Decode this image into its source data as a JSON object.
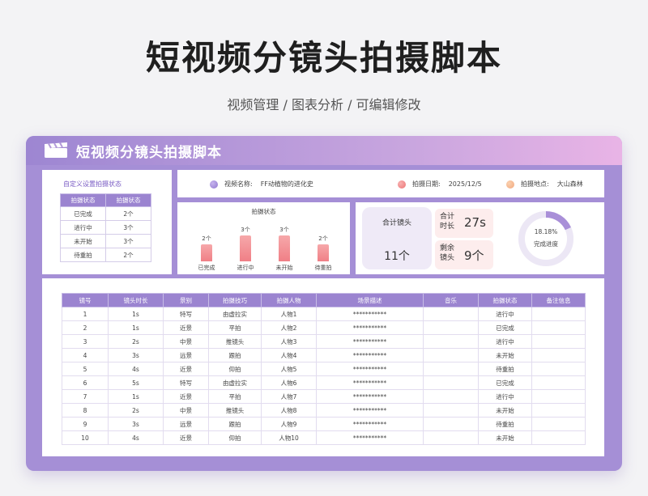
{
  "page": {
    "title": "短视频分镜头拍摄脚本",
    "subtitle": "视频管理 / 图表分析 /  可编辑修改"
  },
  "card": {
    "title": "短视频分镜头拍摄脚本",
    "icon": "clapperboard-icon",
    "colors": {
      "accent": "#9b84d0",
      "bar": "#f07f86",
      "donut": "#a98fd8"
    }
  },
  "status_panel": {
    "title": "自定义设置拍摄状态",
    "headers": [
      "拍摄状态",
      "拍摄状态"
    ],
    "rows": [
      {
        "status": "已完成",
        "count": "2个"
      },
      {
        "status": "进行中",
        "count": "3个"
      },
      {
        "status": "未开始",
        "count": "3个"
      },
      {
        "status": "待重拍",
        "count": "2个"
      }
    ]
  },
  "info": {
    "video_name_label": "视频名称:",
    "video_name": "FF动植物的进化史",
    "date_label": "拍摄日期:",
    "date": "2025/12/5",
    "location_label": "拍摄地点:",
    "location": "大山森林"
  },
  "chart_data": {
    "type": "bar",
    "title": "拍摄状态",
    "categories": [
      "已完成",
      "进行中",
      "未开始",
      "待重拍"
    ],
    "values": [
      2,
      3,
      3,
      2
    ],
    "value_labels": [
      "2个",
      "3个",
      "3个",
      "2个"
    ],
    "ylim": [
      0,
      3
    ],
    "grid": false
  },
  "stats": {
    "total_label": "合计镜头",
    "total_value": "11个",
    "duration_label": "合计时长",
    "duration_value": "27s",
    "remaining_label": "剩余镜头",
    "remaining_value": "9个",
    "progress_value": 0.1818,
    "progress_text": "18.18%",
    "progress_label": "完成进度"
  },
  "table": {
    "headers": [
      "镜号",
      "镜头时长",
      "景别",
      "拍摄技巧",
      "拍摄人物",
      "场景描述",
      "音乐",
      "拍摄状态",
      "备注信息"
    ],
    "rows": [
      [
        "1",
        "1s",
        "特写",
        "由虚拉实",
        "人物1",
        "***********",
        "",
        "进行中",
        ""
      ],
      [
        "2",
        "1s",
        "近景",
        "平拍",
        "人物2",
        "***********",
        "",
        "已完成",
        ""
      ],
      [
        "3",
        "2s",
        "中景",
        "推镜头",
        "人物3",
        "***********",
        "",
        "进行中",
        ""
      ],
      [
        "4",
        "3s",
        "远景",
        "跟拍",
        "人物4",
        "***********",
        "",
        "未开始",
        ""
      ],
      [
        "5",
        "4s",
        "近景",
        "仰拍",
        "人物5",
        "***********",
        "",
        "待重拍",
        ""
      ],
      [
        "6",
        "5s",
        "特写",
        "由虚拉实",
        "人物6",
        "***********",
        "",
        "已完成",
        ""
      ],
      [
        "7",
        "1s",
        "近景",
        "平拍",
        "人物7",
        "***********",
        "",
        "进行中",
        ""
      ],
      [
        "8",
        "2s",
        "中景",
        "推镜头",
        "人物8",
        "***********",
        "",
        "未开始",
        ""
      ],
      [
        "9",
        "3s",
        "远景",
        "跟拍",
        "人物9",
        "***********",
        "",
        "待重拍",
        ""
      ],
      [
        "10",
        "4s",
        "近景",
        "仰拍",
        "人物10",
        "***********",
        "",
        "未开始",
        ""
      ]
    ]
  }
}
